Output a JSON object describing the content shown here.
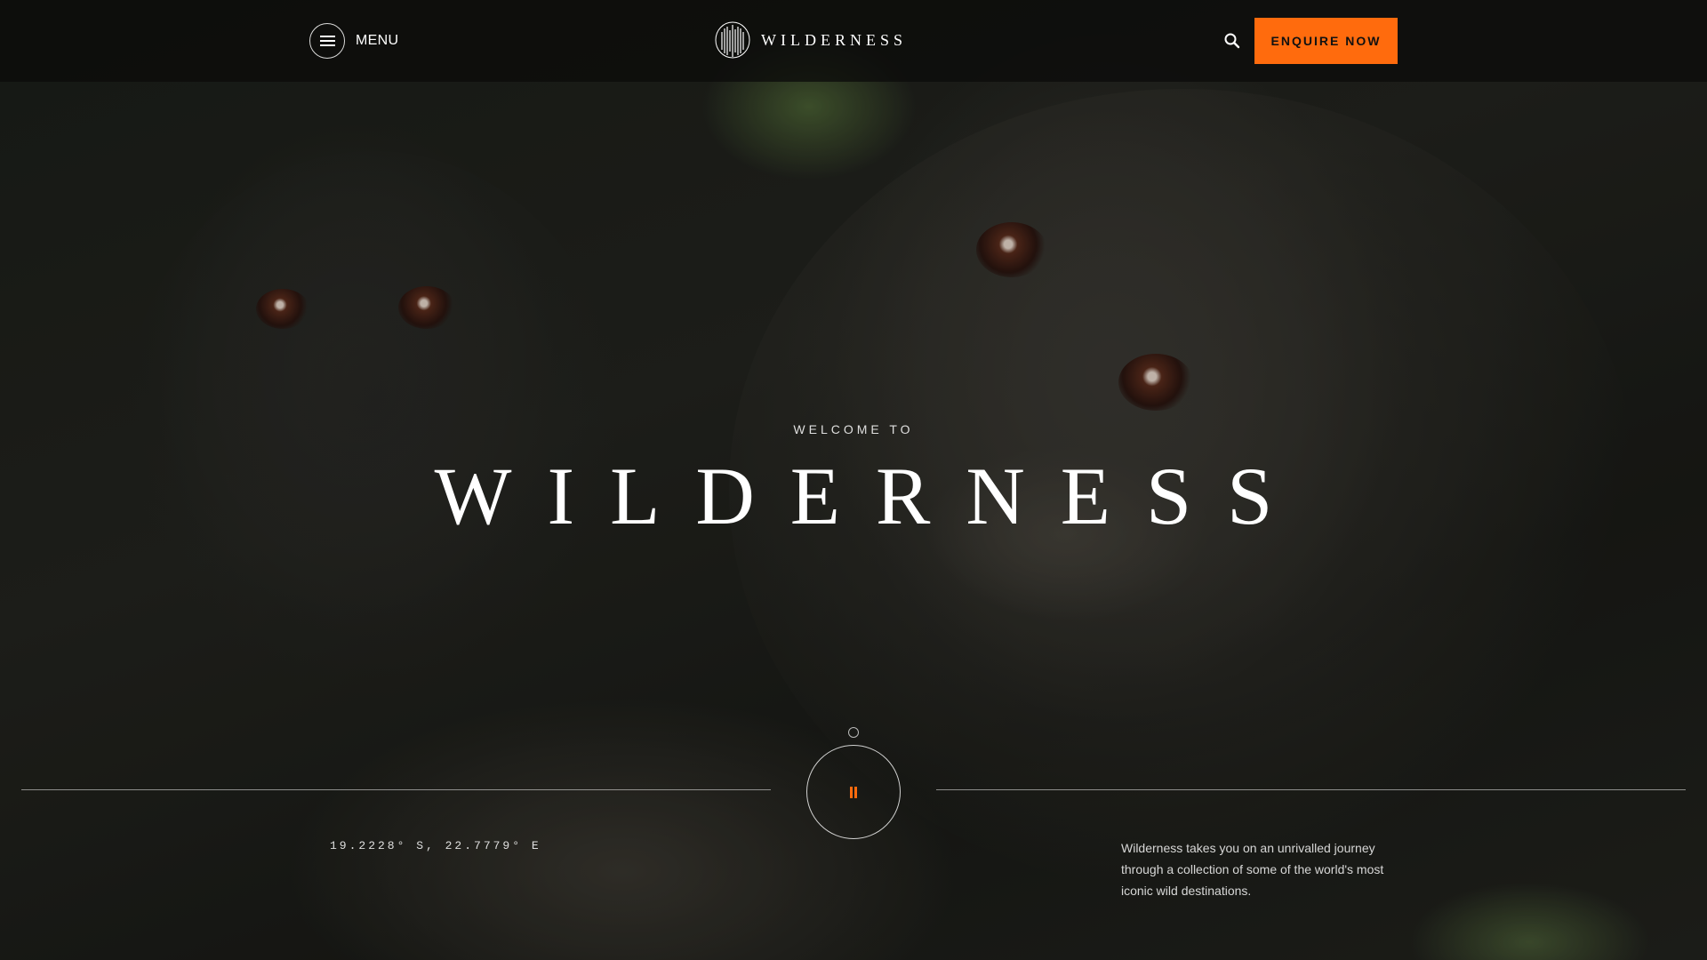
{
  "header": {
    "menu_label": "MENU",
    "logo_text": "WILDERNESS",
    "enquire_label": "ENQUIRE NOW",
    "icons": {
      "menu": "hamburger-icon",
      "logo": "wilderness-logo-mark",
      "search": "search-icon"
    }
  },
  "hero": {
    "eyebrow": "WELCOME TO",
    "title": "WILDERNESS"
  },
  "footer": {
    "coordinates": "19.2228° S, 22.7779° E",
    "description": "Wilderness takes you on an unrivalled journey through a collection of some of the world's most iconic wild destinations.",
    "pause_icon": "pause-icon"
  },
  "colors": {
    "accent": "#ff6b0d",
    "header_bg": "#0c0c0a",
    "text": "#ffffff"
  }
}
